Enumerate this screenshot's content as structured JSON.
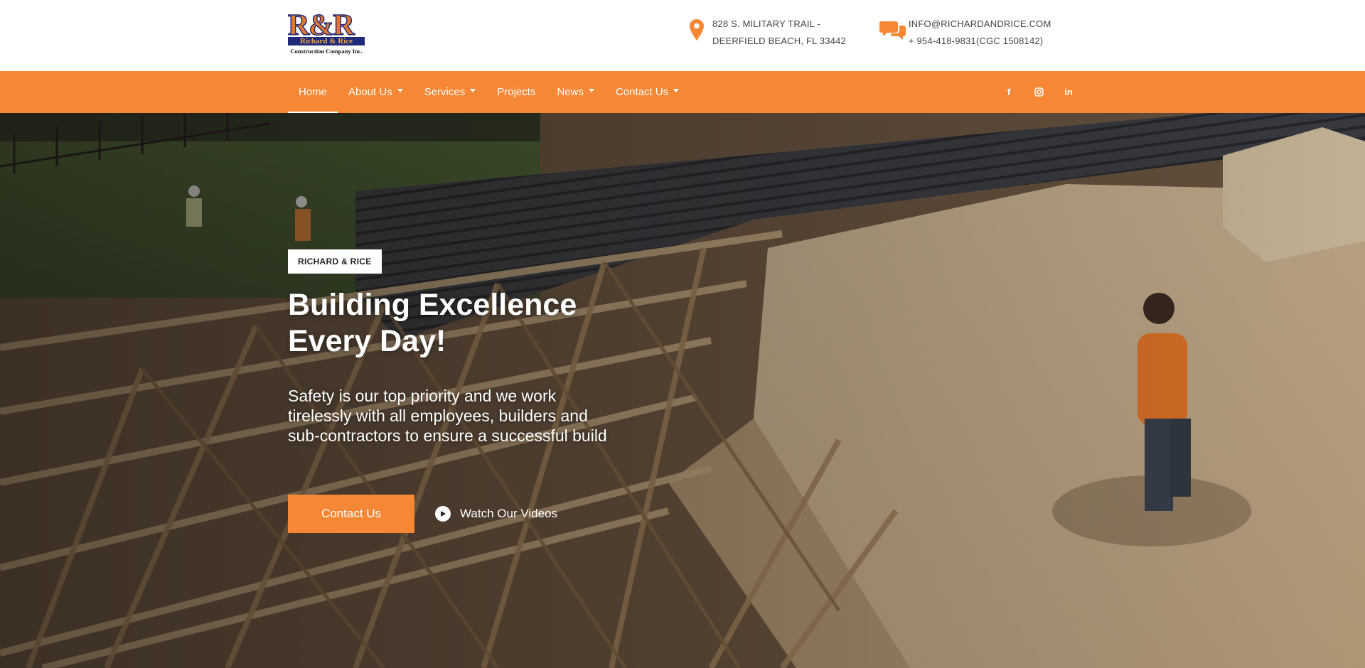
{
  "brand": {
    "logo_monogram": "R&R",
    "logo_name": "Richard & Rice",
    "logo_tagline": "Construction Company Inc."
  },
  "header": {
    "address_line1": "828 S. MILITARY TRAIL -",
    "address_line2": "DEERFIELD BEACH, FL 33442",
    "email": "INFO@RICHARDANDRICE.COM",
    "phone": "+ 954-418-9831(CGC 1508142)",
    "address_icon": "map-pin-icon",
    "contact_icon": "chat-bubbles-icon"
  },
  "nav": {
    "items": [
      {
        "label": "Home",
        "active": true,
        "dropdown": false
      },
      {
        "label": "About Us",
        "active": false,
        "dropdown": true
      },
      {
        "label": "Services",
        "active": false,
        "dropdown": true
      },
      {
        "label": "Projects",
        "active": false,
        "dropdown": false
      },
      {
        "label": "News",
        "active": false,
        "dropdown": true
      },
      {
        "label": "Contact Us",
        "active": false,
        "dropdown": true
      }
    ],
    "social": [
      {
        "icon": "facebook-icon",
        "glyph": "f"
      },
      {
        "icon": "instagram-icon",
        "glyph": ""
      },
      {
        "icon": "linkedin-icon",
        "glyph": "in"
      }
    ]
  },
  "hero": {
    "tag": "RICHARD & RICE",
    "headline_line1": "Building Excellence",
    "headline_line2": "Every Day!",
    "lead": "Safety is our top priority and we work tirelessly with all employees, builders and sub-contractors to ensure a successful build",
    "primary_button": "Contact Us",
    "secondary_button": "Watch Our Videos",
    "secondary_icon": "play-circle-icon"
  },
  "colors": {
    "accent": "#f58735",
    "brand_navy": "#1f2a7a",
    "text_dark": "#444444"
  }
}
